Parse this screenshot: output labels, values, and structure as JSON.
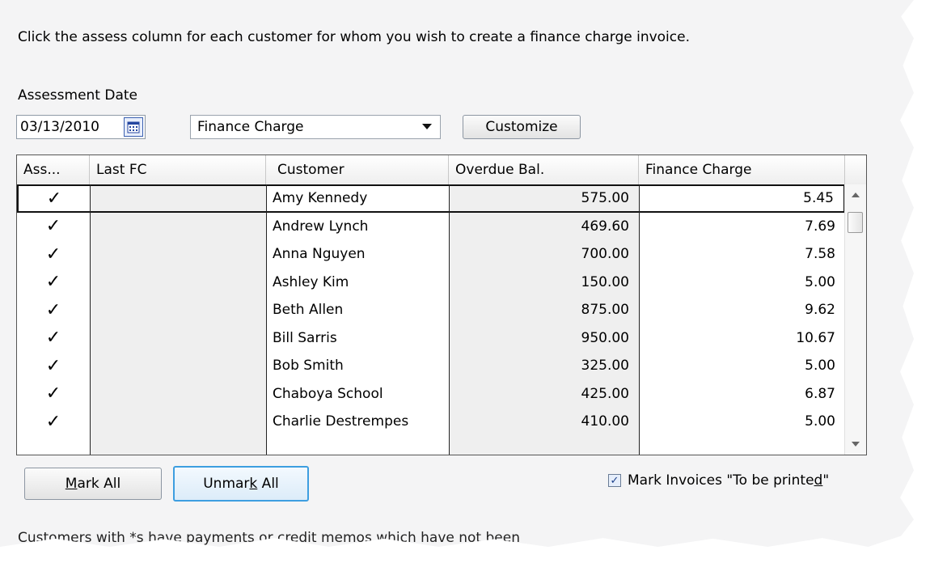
{
  "intro_text": "Click the assess column for each customer for whom you wish to create a finance charge invoice.",
  "assessment_date": {
    "label": "Assessment Date",
    "value": "03/13/2010"
  },
  "template_dropdown": {
    "value": "Finance Charge"
  },
  "buttons": {
    "customize": "Customize",
    "mark_all_pre": "",
    "mark_all_ul": "M",
    "mark_all_post": "ark All",
    "unmark_pre": "Unmar",
    "unmark_ul": "k",
    "unmark_post": " All"
  },
  "table": {
    "headers": {
      "assess": "Ass...",
      "last_fc": "Last FC",
      "customer": "Customer",
      "overdue": "Overdue Bal.",
      "finance": "Finance Charge"
    },
    "rows": [
      {
        "check": "✓",
        "last_fc": "",
        "customer": "Amy Kennedy",
        "overdue": "575.00",
        "finance": "5.45"
      },
      {
        "check": "✓",
        "last_fc": "",
        "customer": "Andrew Lynch",
        "overdue": "469.60",
        "finance": "7.69"
      },
      {
        "check": "✓",
        "last_fc": "",
        "customer": "Anna Nguyen",
        "overdue": "700.00",
        "finance": "7.58"
      },
      {
        "check": "✓",
        "last_fc": "",
        "customer": "Ashley Kim",
        "overdue": "150.00",
        "finance": "5.00"
      },
      {
        "check": "✓",
        "last_fc": "",
        "customer": "Beth Allen",
        "overdue": "875.00",
        "finance": "9.62"
      },
      {
        "check": "✓",
        "last_fc": "",
        "customer": "Bill Sarris",
        "overdue": "950.00",
        "finance": "10.67"
      },
      {
        "check": "✓",
        "last_fc": "",
        "customer": "Bob Smith",
        "overdue": "325.00",
        "finance": "5.00"
      },
      {
        "check": "✓",
        "last_fc": "",
        "customer": "Chaboya School",
        "overdue": "425.00",
        "finance": "6.87"
      },
      {
        "check": "✓",
        "last_fc": "",
        "customer": "Charlie Destrempes",
        "overdue": "410.00",
        "finance": "5.00"
      }
    ]
  },
  "print_option": {
    "pre": "Mark Invoices \"To be printe",
    "ul": "d",
    "post": "\"",
    "checked": true
  },
  "footnote": "Customers with *s have payments or credit memos which have not been"
}
